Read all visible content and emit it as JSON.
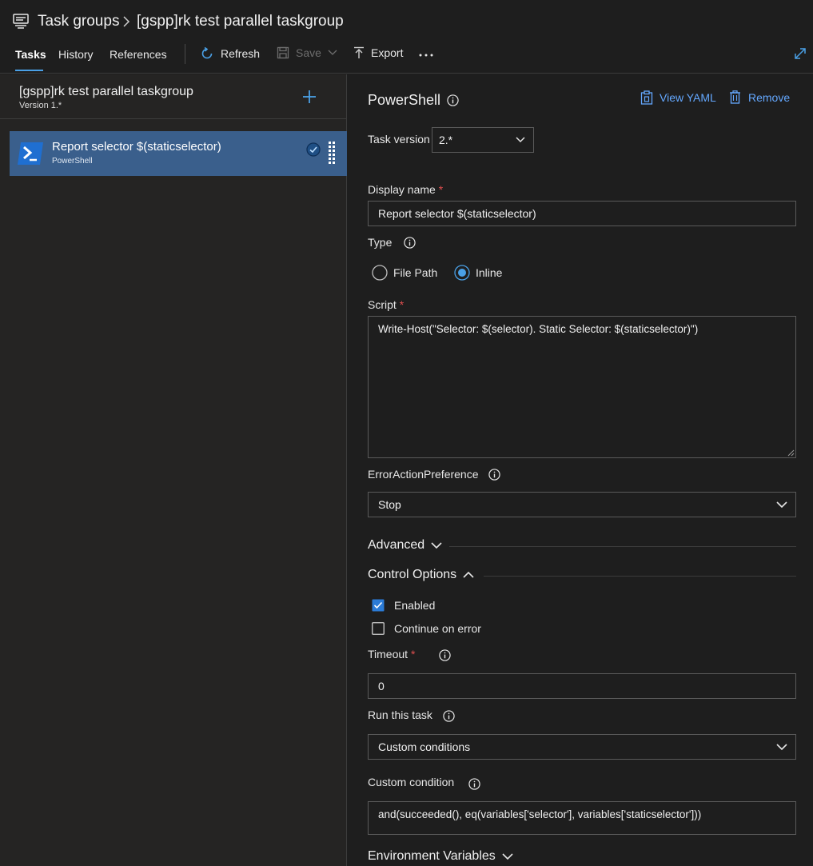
{
  "header": {
    "icon": "task-groups-icon",
    "breadcrumb": [
      "Task groups",
      "[gspp]rk test parallel taskgroup"
    ],
    "tabs": [
      {
        "label": "Tasks",
        "active": true
      },
      {
        "label": "History",
        "active": false
      },
      {
        "label": "References",
        "active": false
      }
    ],
    "toolbar": {
      "refresh": "Refresh",
      "save": "Save",
      "export": "Export"
    }
  },
  "left_panel": {
    "title": "[gspp]rk test parallel taskgroup",
    "version": "Version 1.*",
    "tasks": [
      {
        "title": "Report selector $(staticselector)",
        "subtitle": "PowerShell",
        "selected": true
      }
    ]
  },
  "right_panel": {
    "title": "PowerShell",
    "view_yaml": "View YAML",
    "remove": "Remove",
    "task_version_label": "Task version",
    "task_version_value": "2.*",
    "display_name_label": "Display name",
    "display_name_value": "Report selector $(staticselector)",
    "type_label": "Type",
    "type_options": [
      "File Path",
      "Inline"
    ],
    "type_selected": "Inline",
    "script_label": "Script",
    "script_value": "Write-Host(\"Selector:  $(selector).  Static Selector: $(staticselector)\")",
    "erroraction_label": "ErrorActionPreference",
    "erroraction_value": "Stop",
    "advanced_label": "Advanced",
    "control_options_label": "Control Options",
    "enabled_label": "Enabled",
    "enabled_checked": true,
    "continue_on_error_label": "Continue on error",
    "continue_on_error_checked": false,
    "timeout_label": "Timeout",
    "timeout_value": "0",
    "run_task_label": "Run this task",
    "run_task_value": "Custom conditions",
    "custom_condition_label": "Custom condition",
    "custom_condition_value": "and(succeeded(), eq(variables['selector'], variables['staticselector']))",
    "env_vars_label": "Environment Variables"
  },
  "colors": {
    "accent": "#4aa0e6",
    "selected_task_bg": "#3a5f8c",
    "required": "#e04f4f",
    "link": "#64a8ff"
  }
}
